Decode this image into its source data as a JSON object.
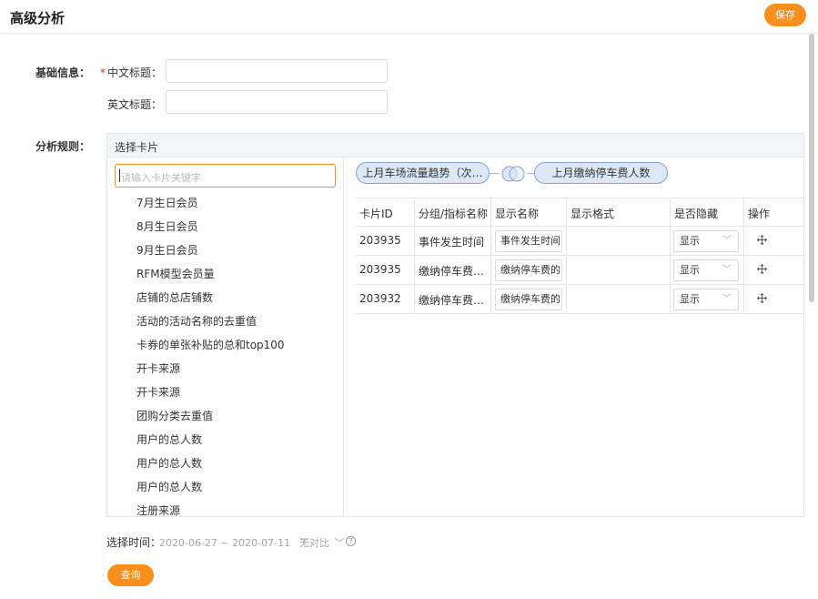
{
  "header": {
    "title": "高级分析",
    "save_label": "保存"
  },
  "basic_info": {
    "section_label": "基础信息：",
    "required_mark": "*",
    "cn_title_label": "中文标题：",
    "cn_title_value": "",
    "en_title_label": "英文标题：",
    "en_title_value": ""
  },
  "rules": {
    "section_label": "分析规则：",
    "panel_title": "选择卡片",
    "search_placeholder": "请输入卡片关键字",
    "cards": [
      "7月生日会员",
      "8月生日会员",
      "9月生日会员",
      "RFM模型会员量",
      "店铺的总店铺数",
      "活动的活动名称的去重值",
      "卡券的单张补贴的总和top100",
      "开卡来源",
      "开卡来源",
      "团购分类去重值",
      "用户的总人数",
      "用户的总人数",
      "用户的总人数",
      "注册来源"
    ],
    "selected": {
      "left_card": "上月车场流量趋势（次…",
      "right_card": "上月缴纳停车费人数"
    },
    "table": {
      "headers": [
        "卡片ID",
        "分组/指标名称",
        "显示名称",
        "显示格式",
        "是否隐藏",
        "操作"
      ],
      "rows": [
        {
          "id": "203935",
          "metric": "事件发生时间",
          "display_name": "事件发生时间",
          "format": "",
          "hidden": "显示"
        },
        {
          "id": "203935",
          "metric": "缴纳停车费…",
          "display_name": "缴纳停车费的",
          "format": "",
          "hidden": "显示"
        },
        {
          "id": "203932",
          "metric": "缴纳停车费…",
          "display_name": "缴纳停车费的",
          "format": "",
          "hidden": "显示"
        }
      ]
    }
  },
  "time": {
    "label": "选择时间：",
    "range": "2020-06-27 ~ 2020-07-11",
    "compare": "无对比",
    "query_label": "查询"
  },
  "colors": {
    "accent": "#f98f1d",
    "pill_bg": "#dde8f7",
    "pill_border": "#7fa3d6",
    "required": "#f5222d"
  },
  "icons": [
    "chevron-down-icon",
    "move-icon",
    "help-icon",
    "venn-icon"
  ]
}
